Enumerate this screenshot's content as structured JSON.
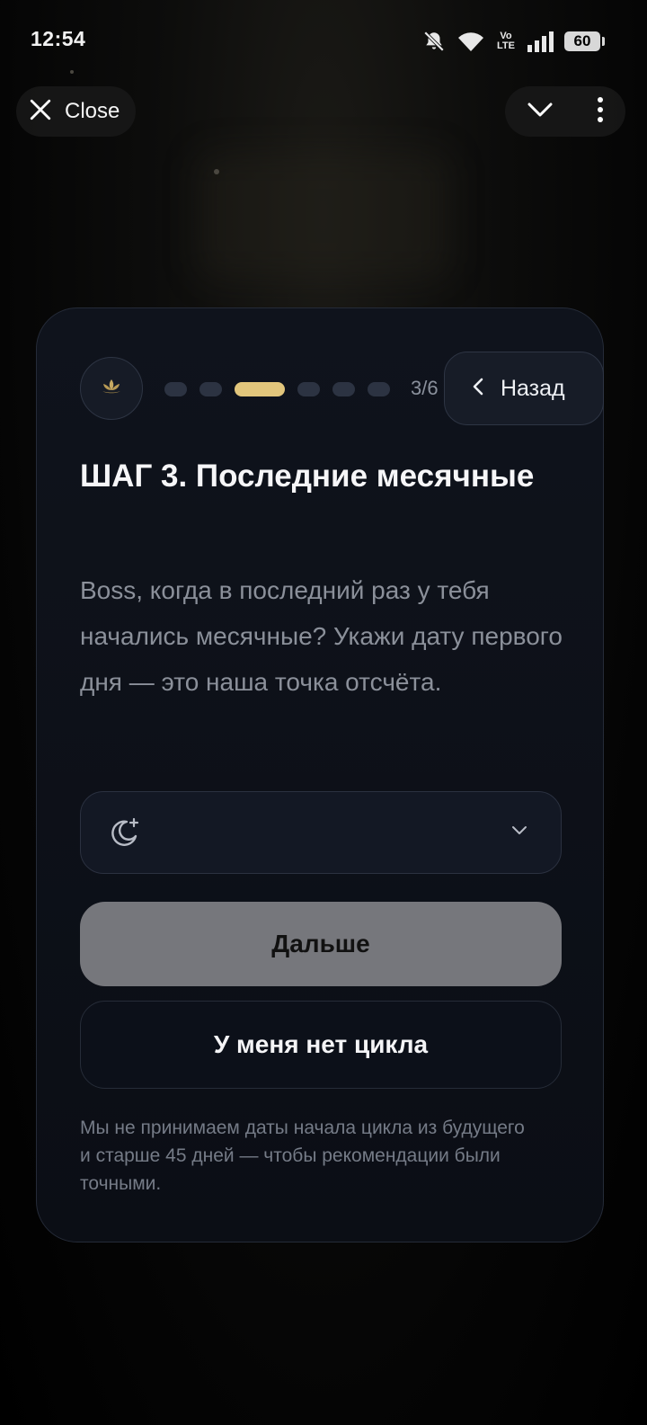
{
  "status_bar": {
    "time": "12:54",
    "network": "Vo LTE",
    "battery": "60",
    "icons": [
      "bell-off-icon",
      "wifi-icon",
      "volte-icon",
      "signal-icon",
      "battery-icon"
    ]
  },
  "top_nav": {
    "close_label": "Close",
    "icons": [
      "close-icon",
      "chevron-down-icon",
      "more-vert-icon"
    ]
  },
  "onboarding": {
    "logo_icon": "lotus-icon",
    "progress": {
      "current": 3,
      "total": 6
    },
    "step_counter": "3/6",
    "back_label": "Назад",
    "title": "ШАГ 3. Последние месячные",
    "description": "Boss, когда в последний раз у тебя начались месячные? Укажи дату первого дня — это наша точка отсчёта.",
    "date_select": {
      "value": "",
      "icons": [
        "moon-icon",
        "chevron-down-icon"
      ]
    },
    "next_label": "Дальше",
    "no_cycle_label": "У меня нет цикла",
    "note": "Мы не принимаем даты начала цикла из будущего и старше 45 дней — чтобы рекомендации были точными."
  },
  "colors": {
    "accent": "#e2c67c",
    "card_bg": "#0f131c",
    "disabled_button": "#76777c",
    "muted_text": "#8b909a"
  }
}
